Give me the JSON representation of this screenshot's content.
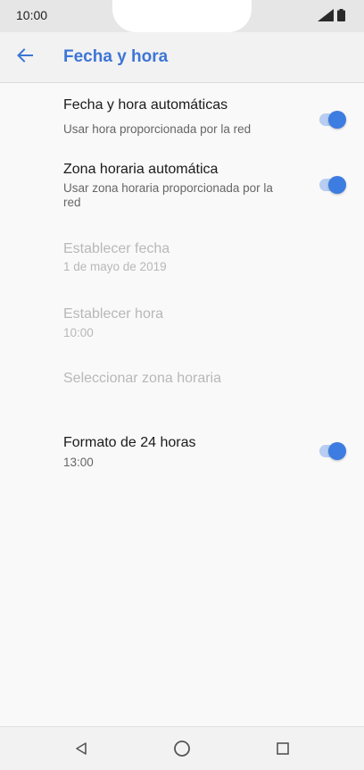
{
  "status_bar": {
    "time": "10:00",
    "icons": [
      "signal-icon",
      "battery-icon"
    ]
  },
  "header": {
    "title": "Fecha y hora",
    "back_icon": "arrow-back-icon"
  },
  "settings": {
    "auto_datetime": {
      "title": "Fecha y hora automáticas",
      "subtitle": "Usar hora proporcionada por la red",
      "enabled": true
    },
    "auto_timezone": {
      "title": "Zona horaria automática",
      "subtitle": "Usar zona horaria proporcionada por la red",
      "enabled": true
    },
    "set_date": {
      "title": "Establecer fecha",
      "subtitle": "1 de mayo de 2019",
      "disabled": true
    },
    "set_time": {
      "title": "Establecer hora",
      "subtitle": "10:00",
      "disabled": true
    },
    "select_timezone": {
      "title": "Seleccionar zona horaria",
      "disabled": true
    },
    "format_24h": {
      "title": "Formato de 24 horas",
      "subtitle": "13:00",
      "enabled": true
    }
  },
  "nav_bar": {
    "icons": [
      "back-triangle-icon",
      "home-circle-icon",
      "recents-square-icon"
    ]
  },
  "colors": {
    "accent": "#3d75d6",
    "toggle_on": "#3d7ce0",
    "toggle_track": "#b8cdf2",
    "disabled_text": "#b8b8b8"
  }
}
